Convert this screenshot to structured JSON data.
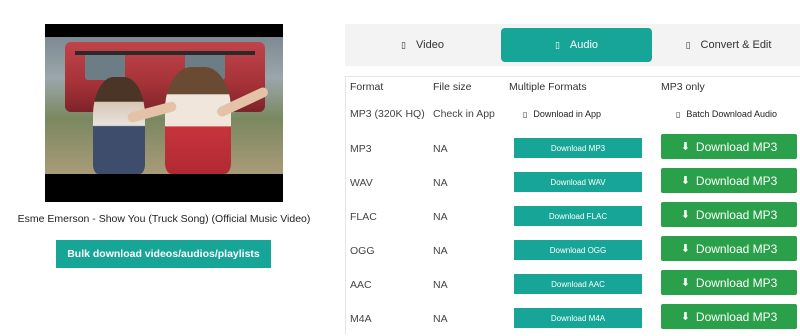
{
  "video": {
    "title": "Esme Emerson - Show You (Truck Song) (Official Music Video)",
    "bulk_button": "Bulk download videos/audios/playlists"
  },
  "tabs": [
    {
      "label": "Video",
      "icon": "video-icon"
    },
    {
      "label": "Audio",
      "icon": "audio-icon",
      "active": true
    },
    {
      "label": "Convert & Edit",
      "icon": "convert-icon"
    }
  ],
  "table": {
    "headers": {
      "format": "Format",
      "file_size": "File size",
      "multiple_formats": "Multiple Formats",
      "mp3_only": "MP3 only"
    },
    "special_row": {
      "format": "MP3 (320K HQ)",
      "size": "Check in App",
      "multi_label": "Download in App",
      "mp3_label": "Batch Download Audio"
    },
    "rows": [
      {
        "format": "MP3",
        "size": "NA",
        "multi": "Download MP3",
        "mp3": "Download MP3"
      },
      {
        "format": "WAV",
        "size": "NA",
        "multi": "Download WAV",
        "mp3": "Download MP3"
      },
      {
        "format": "FLAC",
        "size": "NA",
        "multi": "Download FLAC",
        "mp3": "Download MP3"
      },
      {
        "format": "OGG",
        "size": "NA",
        "multi": "Download OGG",
        "mp3": "Download MP3"
      },
      {
        "format": "AAC",
        "size": "NA",
        "multi": "Download AAC",
        "mp3": "Download MP3"
      },
      {
        "format": "M4A",
        "size": "NA",
        "multi": "Download M4A",
        "mp3": "Download MP3"
      }
    ]
  },
  "colors": {
    "accent": "#16a596",
    "green": "#2aa04a"
  }
}
